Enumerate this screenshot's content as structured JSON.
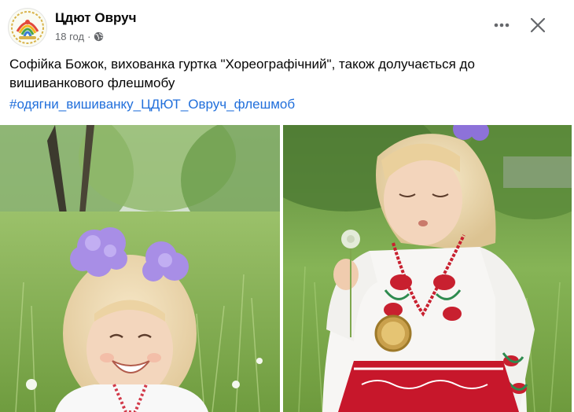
{
  "post": {
    "page_name": "Цдют Овруч",
    "timestamp": "18 год",
    "separator": "·",
    "privacy_icon": "globe-icon",
    "text_lines": [
      "Софійка Божок, вихованка гуртка \"Хореографічний\", також долучається до",
      "вишиванкового флешмобу"
    ],
    "hashtag": "#одягни_вишиванку_ЦДЮТ_Овруч_флешмоб",
    "more_icon": "more-horizontal-icon",
    "close_icon": "close-icon",
    "photos": [
      {
        "name": "photo-left",
        "subject": "smiling girl in field"
      },
      {
        "name": "photo-right",
        "subject": "girl blowing dandelion"
      }
    ]
  },
  "colors": {
    "text": "#050505",
    "meta": "#65676b",
    "link": "#216fdb",
    "background": "#ffffff"
  }
}
